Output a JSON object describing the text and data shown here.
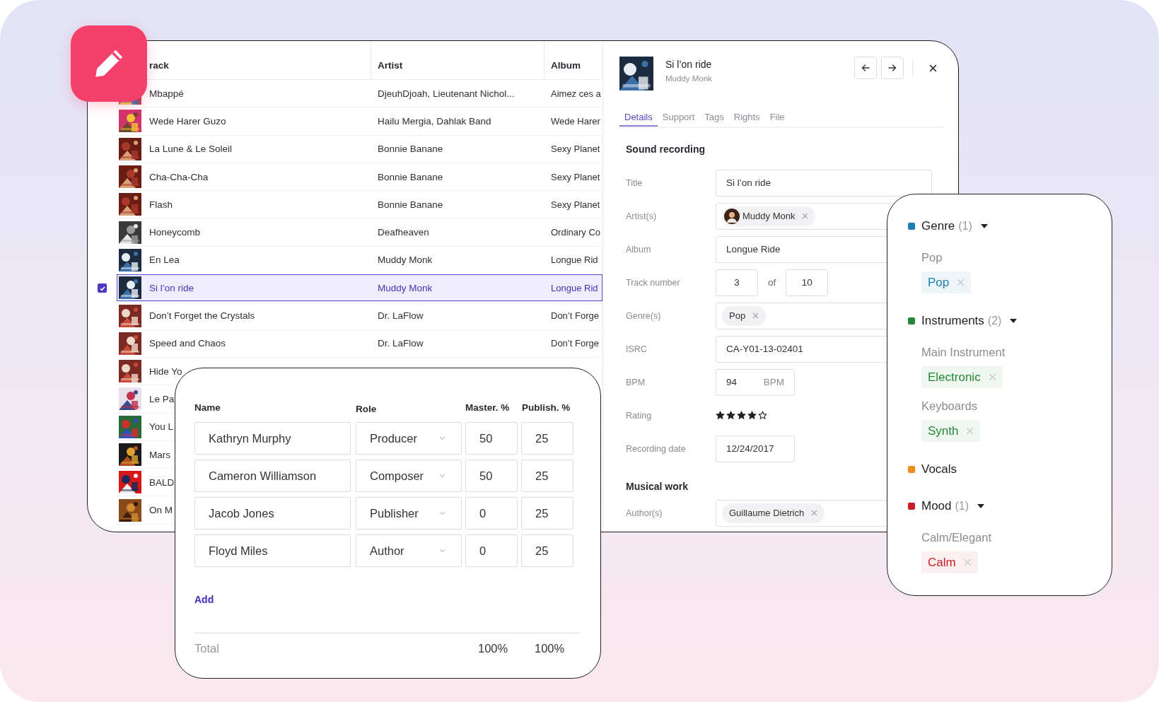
{
  "track_table": {
    "columns": [
      "rack",
      "Artist",
      "Album"
    ],
    "rows": [
      {
        "track": "Mbappé",
        "artist": "DjeuhDjoah, Lieutenant Nichol...",
        "album": "Aimez ces a",
        "selected": false
      },
      {
        "track": "Wede Harer Guzo",
        "artist": "Hailu Mergia, Dahlak Band",
        "album": "Wede Harer",
        "selected": false
      },
      {
        "track": "La Lune & Le Soleil",
        "artist": "Bonnie Banane",
        "album": "Sexy Planet",
        "selected": false
      },
      {
        "track": "Cha-Cha-Cha",
        "artist": "Bonnie Banane",
        "album": "Sexy Planet",
        "selected": false
      },
      {
        "track": "Flash",
        "artist": "Bonnie Banane",
        "album": "Sexy Planet",
        "selected": false
      },
      {
        "track": "Honeycomb",
        "artist": "Deafheaven",
        "album": "Ordinary Co",
        "selected": false
      },
      {
        "track": "En Lea",
        "artist": "Muddy Monk",
        "album": "Longue Rid",
        "selected": false
      },
      {
        "track": "Si l’on ride",
        "artist": "Muddy Monk",
        "album": "Longue Rid",
        "selected": true
      },
      {
        "track": "Don’t Forget the Crystals",
        "artist": "Dr. LaFlow",
        "album": "Don’t Forge",
        "selected": false
      },
      {
        "track": "Speed and Chaos",
        "artist": "Dr. LaFlow",
        "album": "Don’t Forge",
        "selected": false
      },
      {
        "track": "Hide Yo",
        "selected": false
      },
      {
        "track": "Le Pa",
        "selected": false
      },
      {
        "track": "You L",
        "selected": false
      },
      {
        "track": "Mars",
        "selected": false
      },
      {
        "track": "BALD",
        "selected": false
      },
      {
        "track": "On M",
        "selected": false
      }
    ]
  },
  "details": {
    "title": "Si l’on ride",
    "subtitle": "Muddy Monk",
    "tabs": [
      {
        "label": "Details",
        "selected": true
      },
      {
        "label": "Support",
        "selected": false
      },
      {
        "label": "Tags",
        "selected": false
      },
      {
        "label": "Rights",
        "selected": false
      },
      {
        "label": "File",
        "selected": false
      }
    ],
    "sections": [
      {
        "heading": "Sound recording",
        "fields": [
          {
            "kind": "text",
            "label": "Title",
            "value": "Si l’on ride"
          },
          {
            "kind": "chips",
            "label": "Artist(s)",
            "chips": [
              {
                "label": "Muddy Monk",
                "avatar": true
              }
            ]
          },
          {
            "kind": "text",
            "label": "Album",
            "value": "Longue Ride"
          },
          {
            "kind": "pair",
            "label": "Track number",
            "value": "3",
            "joiner": "of",
            "total": "10"
          },
          {
            "kind": "chips",
            "label": "Genre(s)",
            "chips": [
              {
                "label": "Pop",
                "avatar": false
              }
            ]
          },
          {
            "kind": "text",
            "label": "ISRC",
            "value": "CA-Y01-13-02401"
          },
          {
            "kind": "unit",
            "label": "BPM",
            "value": "94",
            "unit": "BPM"
          },
          {
            "kind": "stars",
            "label": "Rating",
            "stars": 4
          },
          {
            "kind": "short",
            "label": "Recording date",
            "value": "12/24/2017"
          }
        ]
      },
      {
        "heading": "Musical work",
        "fields": [
          {
            "kind": "chips",
            "label": "Author(s)",
            "chips": [
              {
                "label": "Guillaume Dietrich",
                "avatar": false
              }
            ]
          }
        ]
      }
    ]
  },
  "tag_panel": {
    "groups": [
      {
        "name": "Genre",
        "count": "(1)",
        "color": "#1b7db3",
        "caret": true,
        "subgroups": [
          {
            "label": "Pop",
            "tags": [
              "Pop"
            ]
          }
        ]
      },
      {
        "name": "Instruments",
        "count": "(2)",
        "color": "#24883a",
        "caret": true,
        "subgroups": [
          {
            "label": "Main Instrument",
            "tags": [
              "Electronic"
            ]
          },
          {
            "label": "Keyboards",
            "tags": [
              "Synth"
            ]
          }
        ]
      },
      {
        "name": "Vocals",
        "color": "#ee8f1a",
        "caret": false
      },
      {
        "name": "Mood",
        "count": "(1)",
        "color": "#c81e28",
        "caret": true,
        "subgroups": [
          {
            "label": "Calm/Elegant",
            "tags": [
              "Calm"
            ]
          }
        ]
      }
    ]
  },
  "credits": {
    "columns": [
      "Name",
      "Role",
      "Master. %",
      "Publish. %"
    ],
    "rows": [
      {
        "name": "Kathryn Murphy",
        "role": "Producer",
        "master": "50",
        "publish": "25"
      },
      {
        "name": "Cameron Williamson",
        "role": "Composer",
        "master": "50",
        "publish": "25"
      },
      {
        "name": "Jacob Jones",
        "role": "Publisher",
        "master": "0",
        "publish": "25"
      },
      {
        "name": "Floyd Miles",
        "role": "Author",
        "master": "0",
        "publish": "25"
      }
    ],
    "add_label": "Add",
    "total": {
      "label": "Total",
      "master": "100%",
      "publish": "100%"
    }
  }
}
